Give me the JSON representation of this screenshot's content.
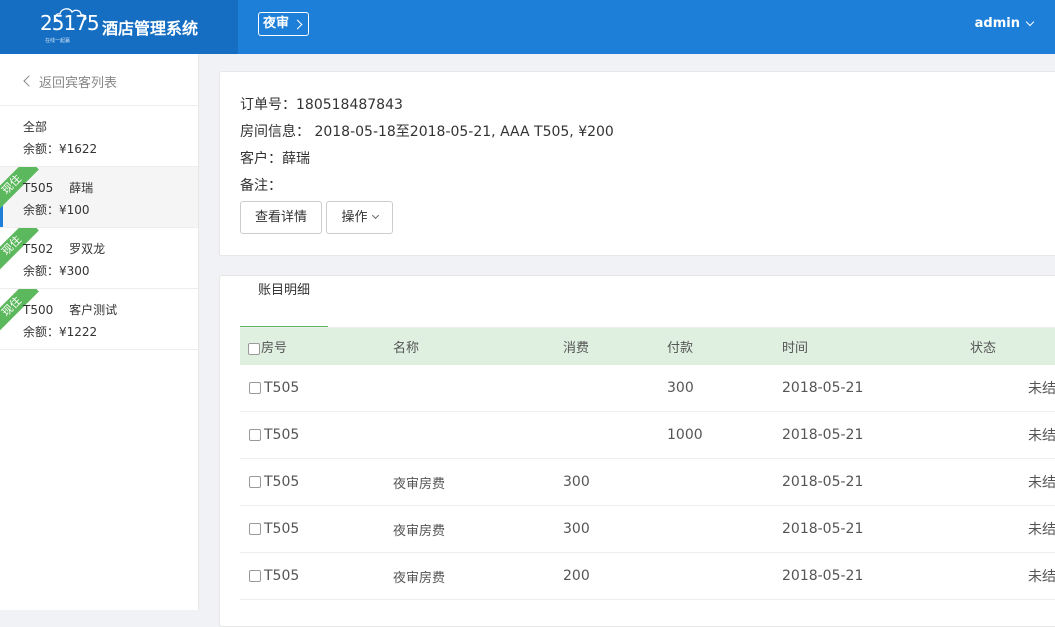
{
  "header": {
    "logo_number": "25175",
    "logo_tagline": "在线一起赢",
    "app_title": "酒店管理系统",
    "night_audit_label": "夜审",
    "user_label": "admin"
  },
  "sidebar": {
    "back_label": "返回宾客列表",
    "items": [
      {
        "room": "全部",
        "guest": "",
        "balance": "余额：¥1622",
        "ribbon": ""
      },
      {
        "room": "T505",
        "guest": "薛瑞",
        "balance": "余额：¥100",
        "ribbon": "现住"
      },
      {
        "room": "T502",
        "guest": "罗双龙",
        "balance": "余额：¥300",
        "ribbon": "现住"
      },
      {
        "room": "T500",
        "guest": "客户测试",
        "balance": "余额：¥1222",
        "ribbon": "现住"
      }
    ]
  },
  "order": {
    "order_no": "订单号：180518487843",
    "room_info": "房间信息： 2018-05-18至2018-05-21, AAA T505, ¥200",
    "customer": "客户：薛瑞",
    "remark": "备注：",
    "detail_button": "查看详情",
    "ops_button": "操作"
  },
  "ledger": {
    "tab_label": "账目明细",
    "columns": [
      "房号",
      "名称",
      "消费",
      "付款",
      "时间",
      "状态"
    ],
    "rows": [
      {
        "room": "T505",
        "name": "",
        "spend": "",
        "pay": "300",
        "time": "2018-05-21",
        "status": "未结"
      },
      {
        "room": "T505",
        "name": "",
        "spend": "",
        "pay": "1000",
        "time": "2018-05-21",
        "status": "未结"
      },
      {
        "room": "T505",
        "name": "夜审房费",
        "spend": "300",
        "pay": "",
        "time": "2018-05-21",
        "status": "未结"
      },
      {
        "room": "T505",
        "name": "夜审房费",
        "spend": "300",
        "pay": "",
        "time": "2018-05-21",
        "status": "未结"
      },
      {
        "room": "T505",
        "name": "夜审房费",
        "spend": "200",
        "pay": "",
        "time": "2018-05-21",
        "status": "未结"
      }
    ]
  },
  "colors": {
    "topbar": "#1e7fd9",
    "logo_bg": "#156ec2",
    "ribbon": "#5cb85c",
    "table_header": "#dff0e1"
  }
}
